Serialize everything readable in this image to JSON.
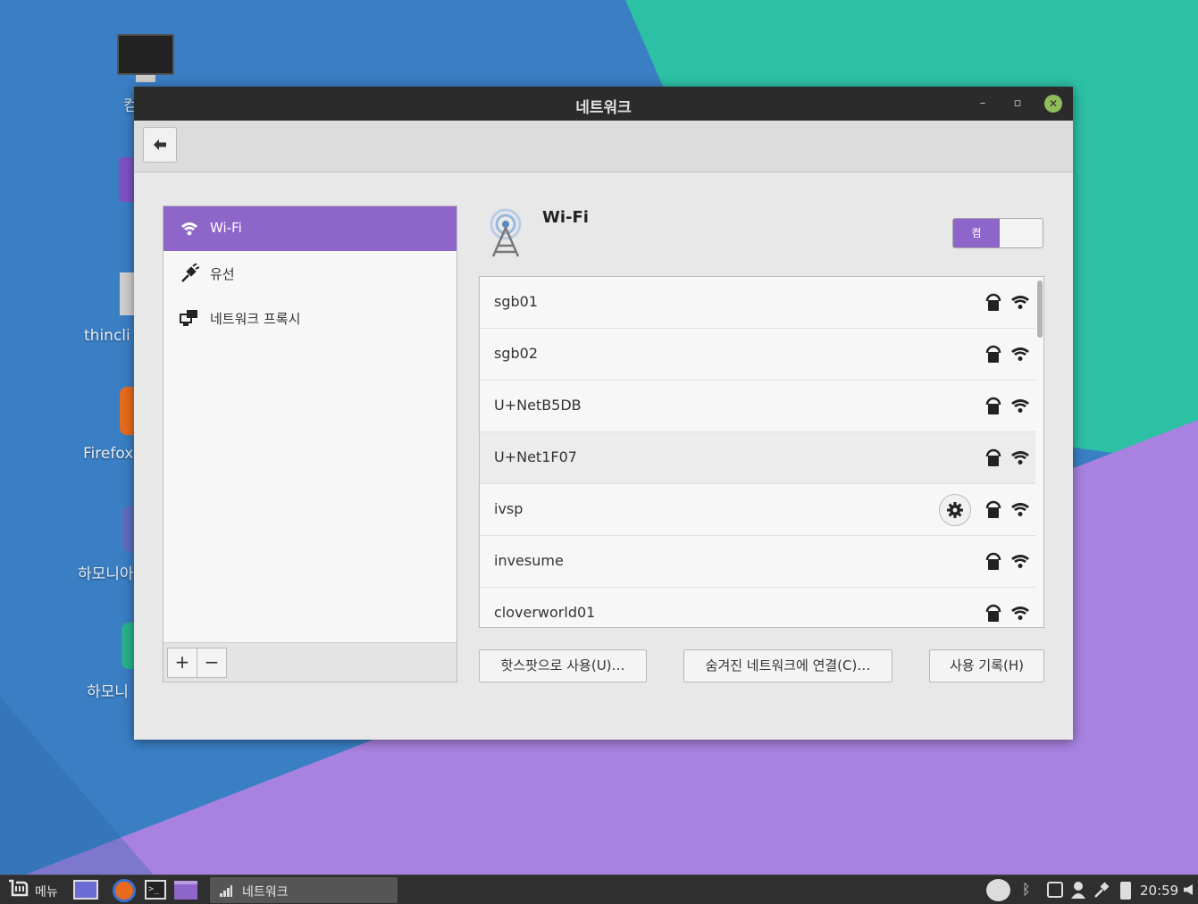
{
  "colors": {
    "accent": "#8e65c9",
    "titlebar": "#2b2b2b",
    "desktop_blue": "#3a7fc4",
    "desktop_teal": "#2cc0a5",
    "desktop_purple": "#a882e0"
  },
  "desktop": {
    "icons": [
      {
        "label": "컴",
        "icon": "computer-icon"
      },
      {
        "label": "thincli",
        "icon": "thinclient-icon"
      },
      {
        "label": "Firefox",
        "icon": "firefox-icon"
      },
      {
        "label": "하모니아",
        "icon": "harmonia-icon"
      },
      {
        "label": "하모니",
        "icon": "harmonia-app-icon"
      }
    ]
  },
  "window": {
    "title": "네트워크",
    "controls": {
      "minimize": "–",
      "maximize": "▫",
      "close": "✕"
    },
    "toolbar": {
      "back_icon": "back-arrow-icon"
    },
    "sidebar": {
      "items": [
        {
          "label": "Wi-Fi",
          "icon": "wifi-icon",
          "active": true
        },
        {
          "label": "유선",
          "icon": "wired-plug-icon",
          "active": false
        },
        {
          "label": "네트워크 프록시",
          "icon": "network-proxy-icon",
          "active": false
        }
      ],
      "add_label": "+",
      "remove_label": "−"
    },
    "wifi_panel": {
      "title": "Wi-Fi",
      "toggle_label": "켬",
      "toggle_on": true,
      "networks": [
        {
          "name": "sgb01",
          "secured": true,
          "settings": false
        },
        {
          "name": "sgb02",
          "secured": true,
          "settings": false
        },
        {
          "name": "U+NetB5DB",
          "secured": true,
          "settings": false
        },
        {
          "name": "U+Net1F07",
          "secured": true,
          "settings": false
        },
        {
          "name": "ivsp",
          "secured": true,
          "settings": true
        },
        {
          "name": "invesume",
          "secured": true,
          "settings": false
        },
        {
          "name": "cloverworld01",
          "secured": true,
          "settings": false
        }
      ],
      "buttons": {
        "hotspot": "핫스팟으로 사용(U)…",
        "hidden": "숨겨진 네트워크에 연결(C)…",
        "history": "사용 기록(H)"
      }
    }
  },
  "taskbar": {
    "menu_label": "메뉴",
    "task_label": "네트워크",
    "clock": "20:59"
  }
}
